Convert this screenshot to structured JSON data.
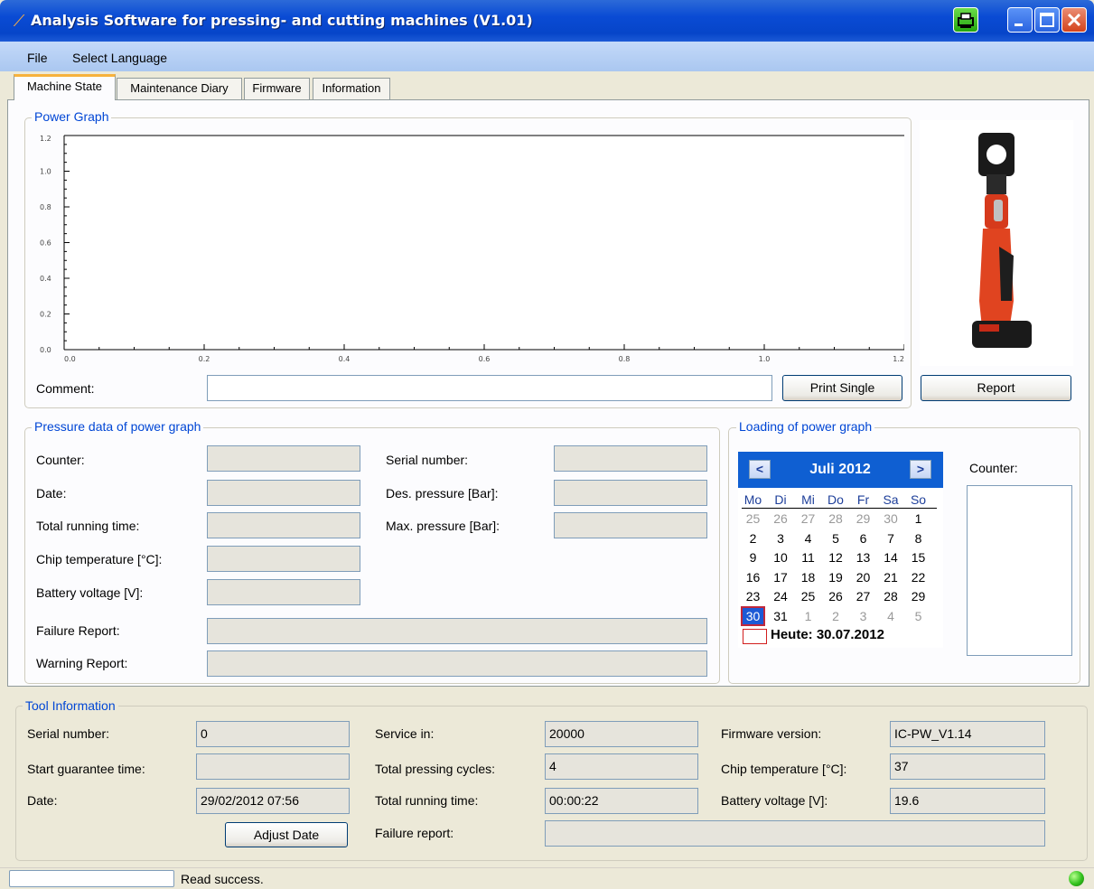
{
  "window": {
    "title": "Analysis Software for pressing- and cutting machines (V1.01)"
  },
  "menu": {
    "file": "File",
    "select_language": "Select Language"
  },
  "tabs": [
    "Machine State",
    "Maintenance Diary",
    "Firmware",
    "Information"
  ],
  "power_graph": {
    "title": "Power Graph",
    "comment_label": "Comment:",
    "comment_value": "",
    "print_single": "Print Single"
  },
  "chart_data": {
    "type": "line",
    "series": [],
    "x_ticks": [
      "0.0",
      "0.2",
      "0.4",
      "0.6",
      "0.8",
      "1.0",
      "1.2"
    ],
    "y_ticks": [
      "0.0",
      "0.2",
      "0.4",
      "0.6",
      "0.8",
      "1.0",
      "1.2"
    ],
    "xlim": [
      0,
      1.2
    ],
    "ylim": [
      0,
      1.2
    ]
  },
  "report_button": "Report",
  "pressure_data": {
    "title": "Pressure data of power graph",
    "counter": "Counter:",
    "date": "Date:",
    "total_running_time": "Total running time:",
    "chip_temperature": "Chip temperature [°C]:",
    "battery_voltage": "Battery voltage [V]:",
    "failure_report": "Failure Report:",
    "warning_report": "Warning Report:",
    "serial_number": "Serial number:",
    "des_pressure": "Des. pressure [Bar]:",
    "max_pressure": "Max. pressure [Bar]:"
  },
  "loading": {
    "title": "Loading of power graph",
    "counter_label": "Counter:",
    "calendar": {
      "month": "Juli 2012",
      "prev": "<",
      "next": ">",
      "weekdays": [
        "Mo",
        "Di",
        "Mi",
        "Do",
        "Fr",
        "Sa",
        "So"
      ],
      "weeks": [
        [
          "25",
          "26",
          "27",
          "28",
          "29",
          "30",
          "1"
        ],
        [
          "2",
          "3",
          "4",
          "5",
          "6",
          "7",
          "8"
        ],
        [
          "9",
          "10",
          "11",
          "12",
          "13",
          "14",
          "15"
        ],
        [
          "16",
          "17",
          "18",
          "19",
          "20",
          "21",
          "22"
        ],
        [
          "23",
          "24",
          "25",
          "26",
          "27",
          "28",
          "29"
        ],
        [
          "30",
          "31",
          "1",
          "2",
          "3",
          "4",
          "5"
        ]
      ],
      "selected": "30",
      "today": "Heute: 30.07.2012"
    }
  },
  "tool_info": {
    "title": "Tool Information",
    "serial_number_label": "Serial number:",
    "serial_number": "0",
    "start_guarantee_label": "Start guarantee time:",
    "start_guarantee": "",
    "date_label": "Date:",
    "date": "29/02/2012 07:56",
    "adjust_date": "Adjust Date",
    "service_in_label": "Service in:",
    "service_in": "20000",
    "total_pressing_label": "Total pressing cycles:",
    "total_pressing": "4",
    "total_running_label": "Total running time:",
    "total_running": "00:00:22",
    "failure_report_label": "Failure report:",
    "failure_report": "",
    "firmware_label": "Firmware version:",
    "firmware": "IC-PW_V1.14",
    "chip_temp_label": "Chip temperature [°C]:",
    "chip_temp": "37",
    "battery_label": "Battery voltage [V]:",
    "battery": "19.6"
  },
  "status": {
    "text": "Read success."
  },
  "colors": {
    "titlebar": "#0a4bd4",
    "group_title": "#0046d5",
    "status_led": "#32c11d"
  }
}
